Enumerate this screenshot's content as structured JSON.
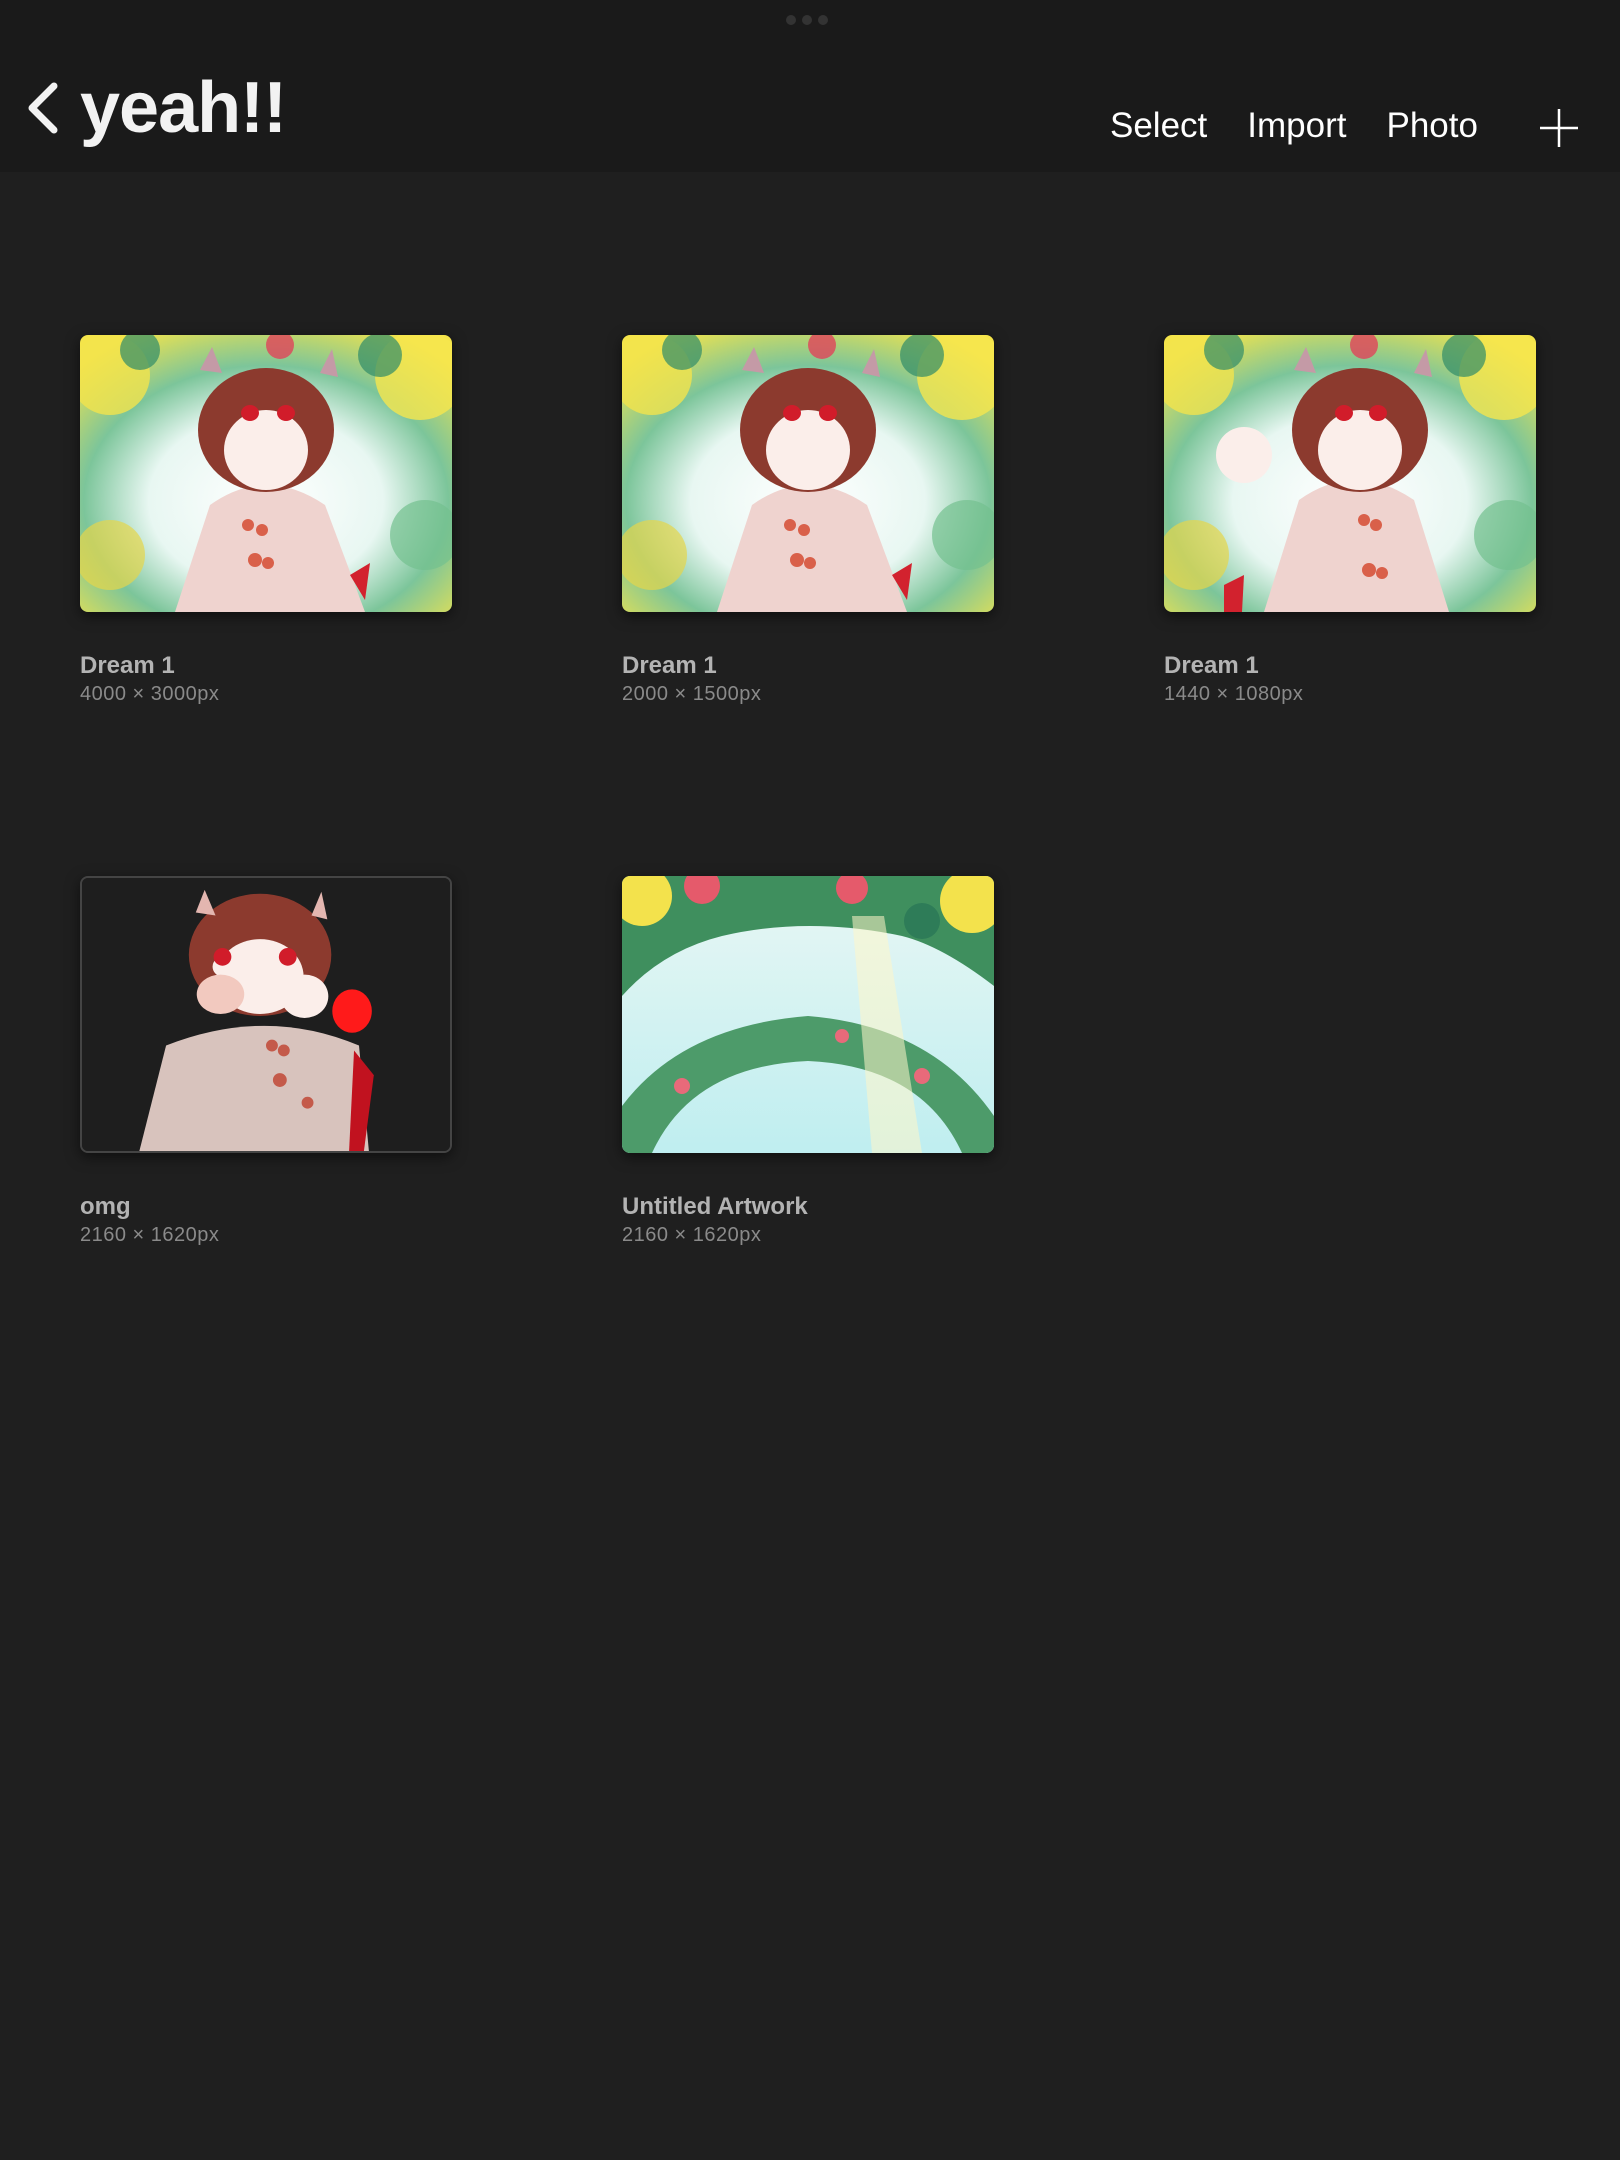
{
  "header": {
    "title": "yeah!!",
    "actions": {
      "select": "Select",
      "import": "Import",
      "photo": "Photo"
    }
  },
  "artworks": [
    {
      "name": "Dream 1",
      "size": "4000 × 3000px"
    },
    {
      "name": "Dream 1",
      "size": "2000 × 1500px"
    },
    {
      "name": "Dream 1",
      "size": "1440 × 1080px"
    },
    {
      "name": "omg",
      "size": "2160 × 1620px"
    },
    {
      "name": "Untitled Artwork",
      "size": "2160 × 1620px"
    }
  ],
  "colors": {
    "background": "#1f1f1f",
    "topbar": "#1a1a1a",
    "title": "#f2f2f2",
    "artwork_name": "#b3b3b3",
    "artwork_size": "#8a8a8a"
  }
}
